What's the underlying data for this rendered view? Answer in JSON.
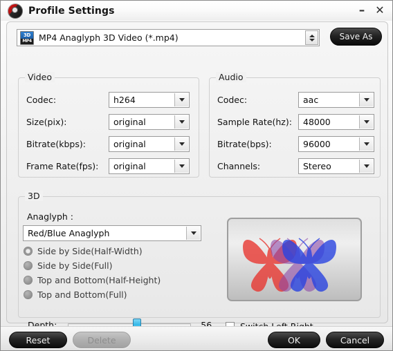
{
  "window": {
    "title": "Profile Settings",
    "app_icon": "disc-logo-icon",
    "minimize_label": "–",
    "close_label": "✕"
  },
  "profile": {
    "icon": "mp4-3d-file-icon",
    "icon_top_text": "3D",
    "icon_bottom_text": "MP4",
    "selected": "MP4 Anaglyph 3D Video (*.mp4)",
    "save_as_label": "Save As"
  },
  "video": {
    "group_title": "Video",
    "fields": [
      {
        "label": "Codec:",
        "value": "h264"
      },
      {
        "label": "Size(pix):",
        "value": "original"
      },
      {
        "label": "Bitrate(kbps):",
        "value": "original"
      },
      {
        "label": "Frame Rate(fps):",
        "value": "original"
      }
    ]
  },
  "audio": {
    "group_title": "Audio",
    "fields": [
      {
        "label": "Codec:",
        "value": "aac"
      },
      {
        "label": "Sample Rate(hz):",
        "value": "48000"
      },
      {
        "label": "Bitrate(bps):",
        "value": "96000"
      },
      {
        "label": "Channels:",
        "value": "Stereo"
      }
    ]
  },
  "threed": {
    "group_title": "3D",
    "anaglyph_label": "Anaglyph :",
    "anaglyph_value": "Red/Blue Anaglyph",
    "modes": [
      {
        "label": "Side by Side(Half-Width)",
        "selected": false
      },
      {
        "label": "Side by Side(Full)",
        "selected": false
      },
      {
        "label": "Top and Bottom(Half-Height)",
        "selected": false
      },
      {
        "label": "Top and Bottom(Full)",
        "selected": false
      }
    ],
    "preview": {
      "name": "anaglyph-butterfly-preview",
      "left_color": "#e8342e",
      "right_color": "#2a44e0"
    },
    "depth_label": "Depth:",
    "depth_value": "56",
    "depth_percent": 56,
    "switch_label": "Switch Left Right",
    "switch_checked": false
  },
  "footer": {
    "reset_label": "Reset",
    "delete_label": "Delete",
    "ok_label": "OK",
    "cancel_label": "Cancel"
  }
}
